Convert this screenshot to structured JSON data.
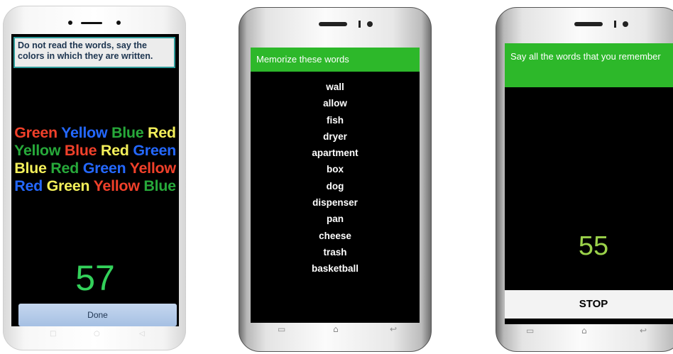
{
  "colors": {
    "red": "#f0402a",
    "green": "#27a93a",
    "blue": "#2468ff",
    "yellow": "#f3ef5a",
    "timer_green": "#33d15a",
    "banner_green": "#2db82a",
    "timer_lime": "#9bd24a"
  },
  "phone1": {
    "instruction_bold": "Do not read the words,",
    "instruction_rest": " say the colors in which they are written.",
    "stroop_rows": [
      [
        {
          "word": "Green",
          "color": "red"
        },
        {
          "word": "Yellow",
          "color": "blue"
        },
        {
          "word": "Blue",
          "color": "green"
        },
        {
          "word": "Red",
          "color": "yellow"
        }
      ],
      [
        {
          "word": "Yellow",
          "color": "green"
        },
        {
          "word": "Blue",
          "color": "red"
        },
        {
          "word": "Red",
          "color": "yellow"
        },
        {
          "word": "Green",
          "color": "blue"
        }
      ],
      [
        {
          "word": "Blue",
          "color": "yellow"
        },
        {
          "word": "Red",
          "color": "green"
        },
        {
          "word": "Green",
          "color": "blue"
        },
        {
          "word": "Yellow",
          "color": "red"
        }
      ],
      [
        {
          "word": "Red",
          "color": "blue"
        },
        {
          "word": "Green",
          "color": "yellow"
        },
        {
          "word": "Yellow",
          "color": "red"
        },
        {
          "word": "Blue",
          "color": "green"
        }
      ]
    ],
    "timer": "57",
    "done_label": "Done",
    "nav_icons": [
      "square-icon",
      "circle-icon",
      "back-triangle-icon"
    ]
  },
  "phone2": {
    "title": "Memorize these words",
    "words": [
      "wall",
      "allow",
      "fish",
      "dryer",
      "apartment",
      "box",
      "dog",
      "dispenser",
      "pan",
      "cheese",
      "trash",
      "basketball"
    ],
    "nav_icons": [
      "recent-apps-icon",
      "home-icon",
      "back-icon"
    ]
  },
  "phone3": {
    "title": "Say all the words that you remember",
    "timer": "55",
    "stop_label": "STOP",
    "nav_icons": [
      "recent-apps-icon",
      "home-icon",
      "back-icon"
    ]
  }
}
